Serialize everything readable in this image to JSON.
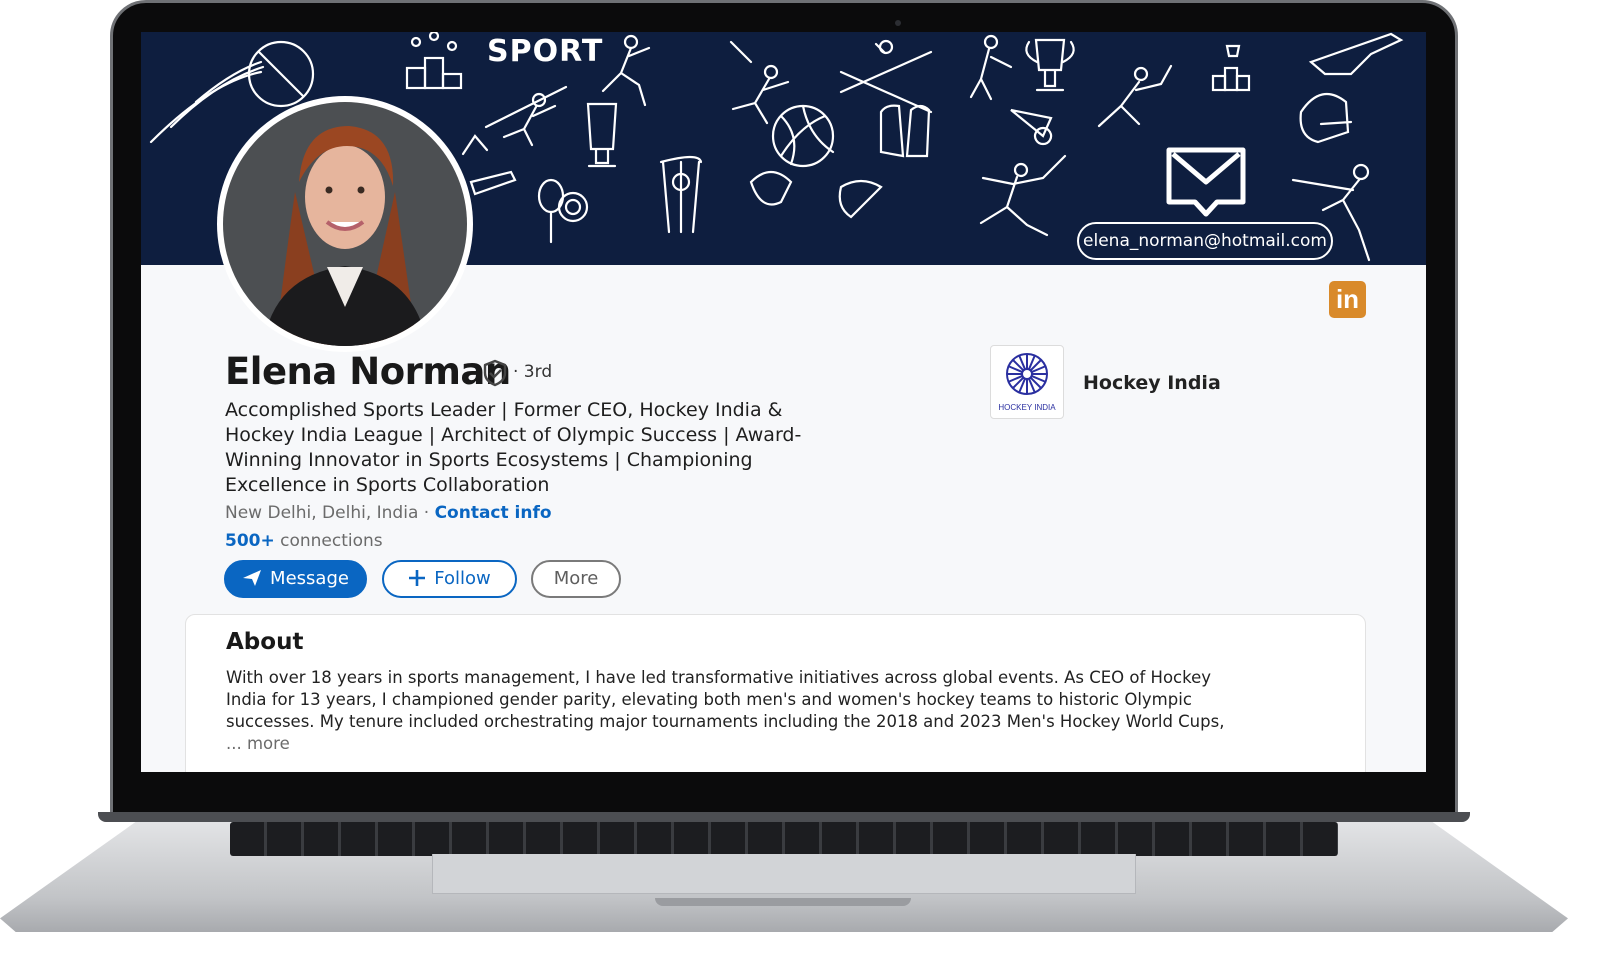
{
  "banner": {
    "title": "SPORT",
    "email": "elena_norman@hotmail.com"
  },
  "profile": {
    "name": "Elena Norman",
    "degree": "· 3rd",
    "headline": "Accomplished Sports Leader  | Former CEO, Hockey India & Hockey India League | Architect of Olympic Success | Award-Winning Innovator in Sports Ecosystems | Championing Excellence in Sports Collaboration",
    "location": "New Delhi, Delhi, India ·",
    "contact_label": "Contact info",
    "connections_count": "500+",
    "connections_label": "connections"
  },
  "actions": {
    "message_label": "Message",
    "follow_label": "Follow",
    "more_label": "More"
  },
  "company": {
    "name": "Hockey India",
    "logo_text": "HOCKEY INDIA"
  },
  "about": {
    "title": "About",
    "text": "With over 18 years in sports management, I have led transformative initiatives across global events. As CEO of Hockey India for 13 years, I championed gender parity, elevating both men's and women's hockey teams to historic Olympic successes. My tenure included orchestrating major tournaments including the 2018 and 2023 Men's Hockey World Cups,",
    "more_label": "... more"
  },
  "badge": {
    "linkedin_text": "in"
  },
  "colors": {
    "banner_bg": "#0e1e3f",
    "accent_blue": "#0a66c2",
    "badge_orange": "#d98a2a"
  },
  "icons": [
    "mail-icon",
    "verified-shield-icon",
    "send-icon",
    "plus-icon",
    "linkedin-icon",
    "cricket-ball-icon",
    "trophy-icon",
    "volleyball-icon",
    "shuttlecock-icon",
    "helmet-icon"
  ]
}
